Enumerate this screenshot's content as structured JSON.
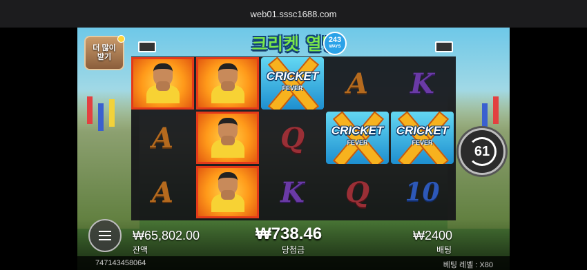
{
  "browser": {
    "url": "web01.sssc1688.com"
  },
  "game": {
    "title": "크리켓 열병",
    "ways": "243",
    "ways_sub": "WAYS",
    "promo_line1": "더 많이",
    "promo_line2": "받기",
    "spins_left": "61",
    "balance_value": "₩65,802.00",
    "balance_label": "잔액",
    "win_value": "₩738.46",
    "win_label": "당첨금",
    "bet_value": "₩2400",
    "bet_label": "배팅",
    "round_id": "747143458064",
    "bet_level_label": "베팅 레벨 : X80"
  },
  "reels": [
    [
      "player",
      "A",
      "A"
    ],
    [
      "player",
      "player",
      "player"
    ],
    [
      "scatter",
      "Q",
      "K"
    ],
    [
      "A",
      "scatter",
      "Q"
    ],
    [
      "K",
      "scatter",
      "10"
    ]
  ],
  "win_cells": [
    [
      0,
      0
    ],
    [
      1,
      0
    ],
    [
      1,
      1
    ],
    [
      1,
      2
    ]
  ],
  "scatter_text": {
    "line1": "CRICKET",
    "line2": "FEVER"
  },
  "colors": {
    "win_border": "#e33a1a",
    "logo_green": "#7be84a",
    "scatter_blue": "#1e8fd0"
  }
}
